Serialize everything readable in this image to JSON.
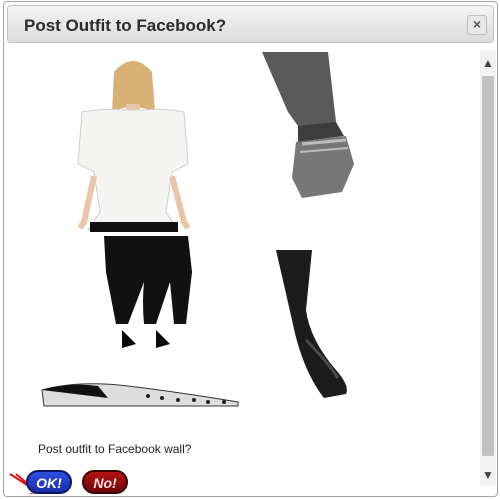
{
  "dialog": {
    "title": "Post Outfit to Facebook?",
    "close_icon": "close-icon",
    "question": "Post outfit to Facebook wall?",
    "ok_label": "OK!",
    "no_label": "No!"
  },
  "items": [
    {
      "name": "white-peplum-top",
      "icon": "top-image"
    },
    {
      "name": "silver-bracelet-on-hand",
      "icon": "bracelet-image"
    },
    {
      "name": "black-trousers",
      "icon": "pants-image"
    },
    {
      "name": "black-stockings",
      "icon": "hosiery-image"
    },
    {
      "name": "animal-print-flat",
      "icon": "shoe-image"
    }
  ],
  "colors": {
    "ok_button": "#2038c8",
    "no_button": "#8a0b0b",
    "annotation_arrow": "#e01010"
  }
}
